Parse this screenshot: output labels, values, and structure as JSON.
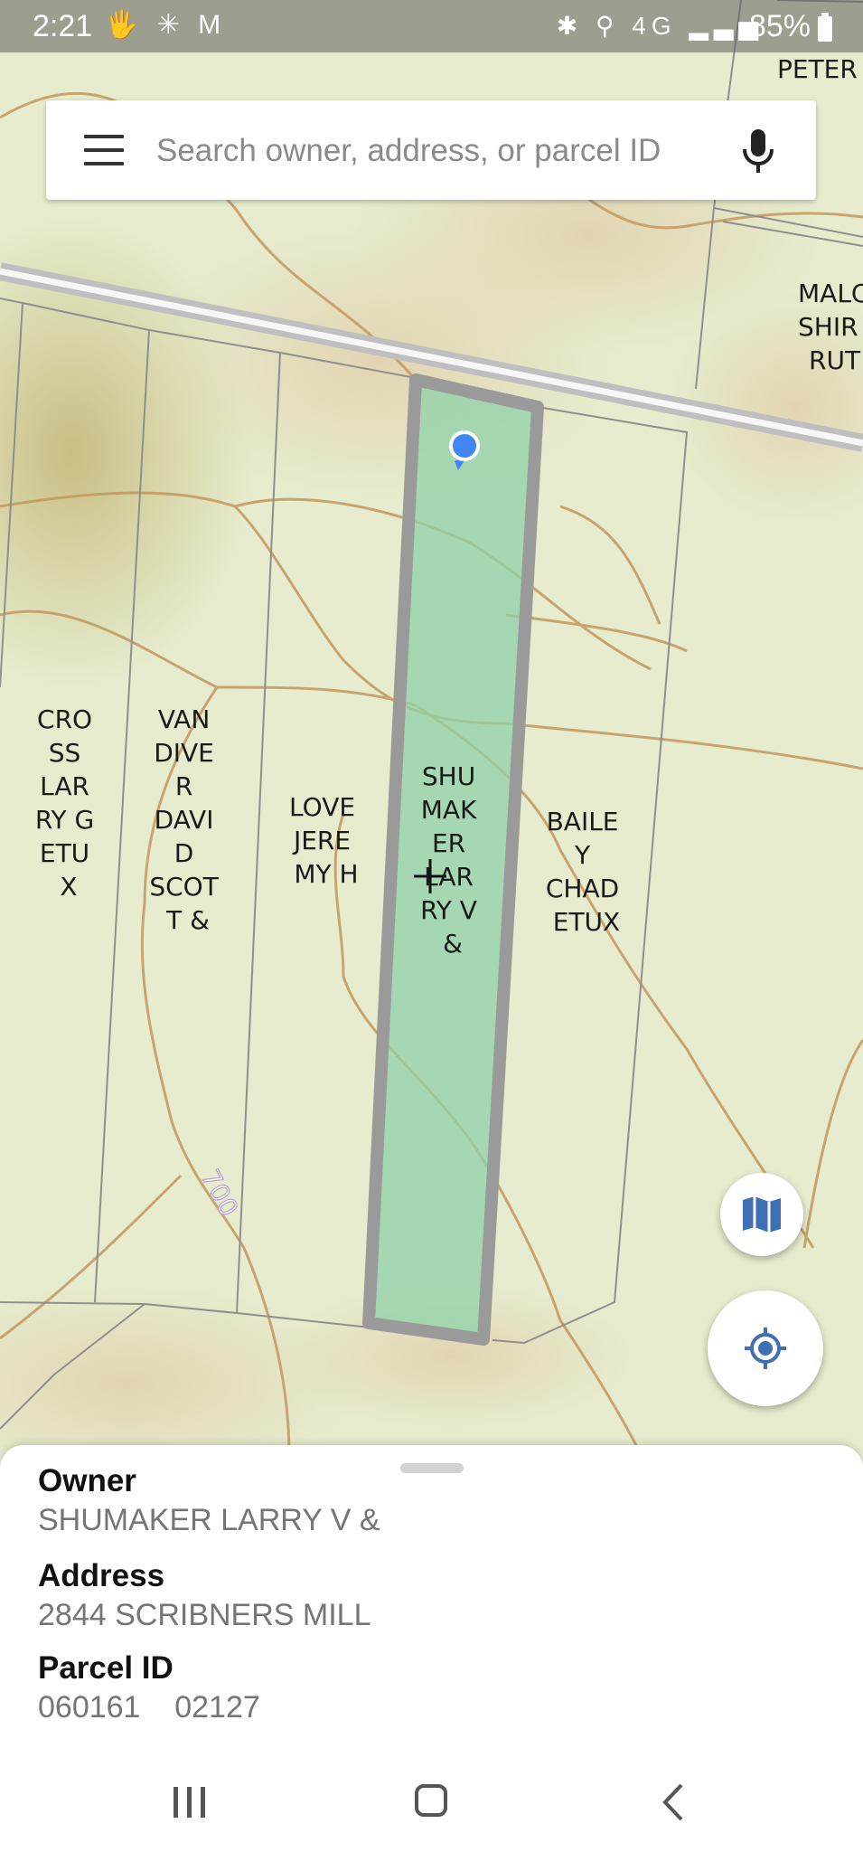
{
  "status_bar": {
    "time": "2:21",
    "left_icons": "🖐 ✳ M",
    "right_icons": "✱ ⚲ 4G ▂▃▅",
    "battery": "85%"
  },
  "search": {
    "placeholder": "Search owner, address, or parcel ID"
  },
  "map": {
    "highlight_color": "#8fd1a8",
    "parcel_labels": [
      [
        "CRO",
        "SS",
        "LAR",
        "RY G",
        "ETU",
        "X"
      ],
      [
        "VAN",
        "DIVE",
        "R",
        "DAVI",
        "D",
        "SCOT",
        "T &"
      ],
      [
        "LOVE",
        "JERE",
        "MY H"
      ],
      [
        "SHU",
        "MAK",
        "ER",
        "LAR",
        "RY V",
        "&"
      ],
      [
        "BAILE",
        "Y",
        "CHAD",
        "ETUX"
      ],
      [
        "MALC",
        "SHIR",
        "RUT"
      ],
      [
        "PETER"
      ]
    ],
    "contour_label": "700"
  },
  "info": {
    "owner_label": "Owner",
    "owner_value": "SHUMAKER LARRY V &",
    "address_label": "Address",
    "address_value": "2844 SCRIBNERS MILL",
    "parcel_label": "Parcel ID",
    "parcel_value": "060161    02127"
  }
}
